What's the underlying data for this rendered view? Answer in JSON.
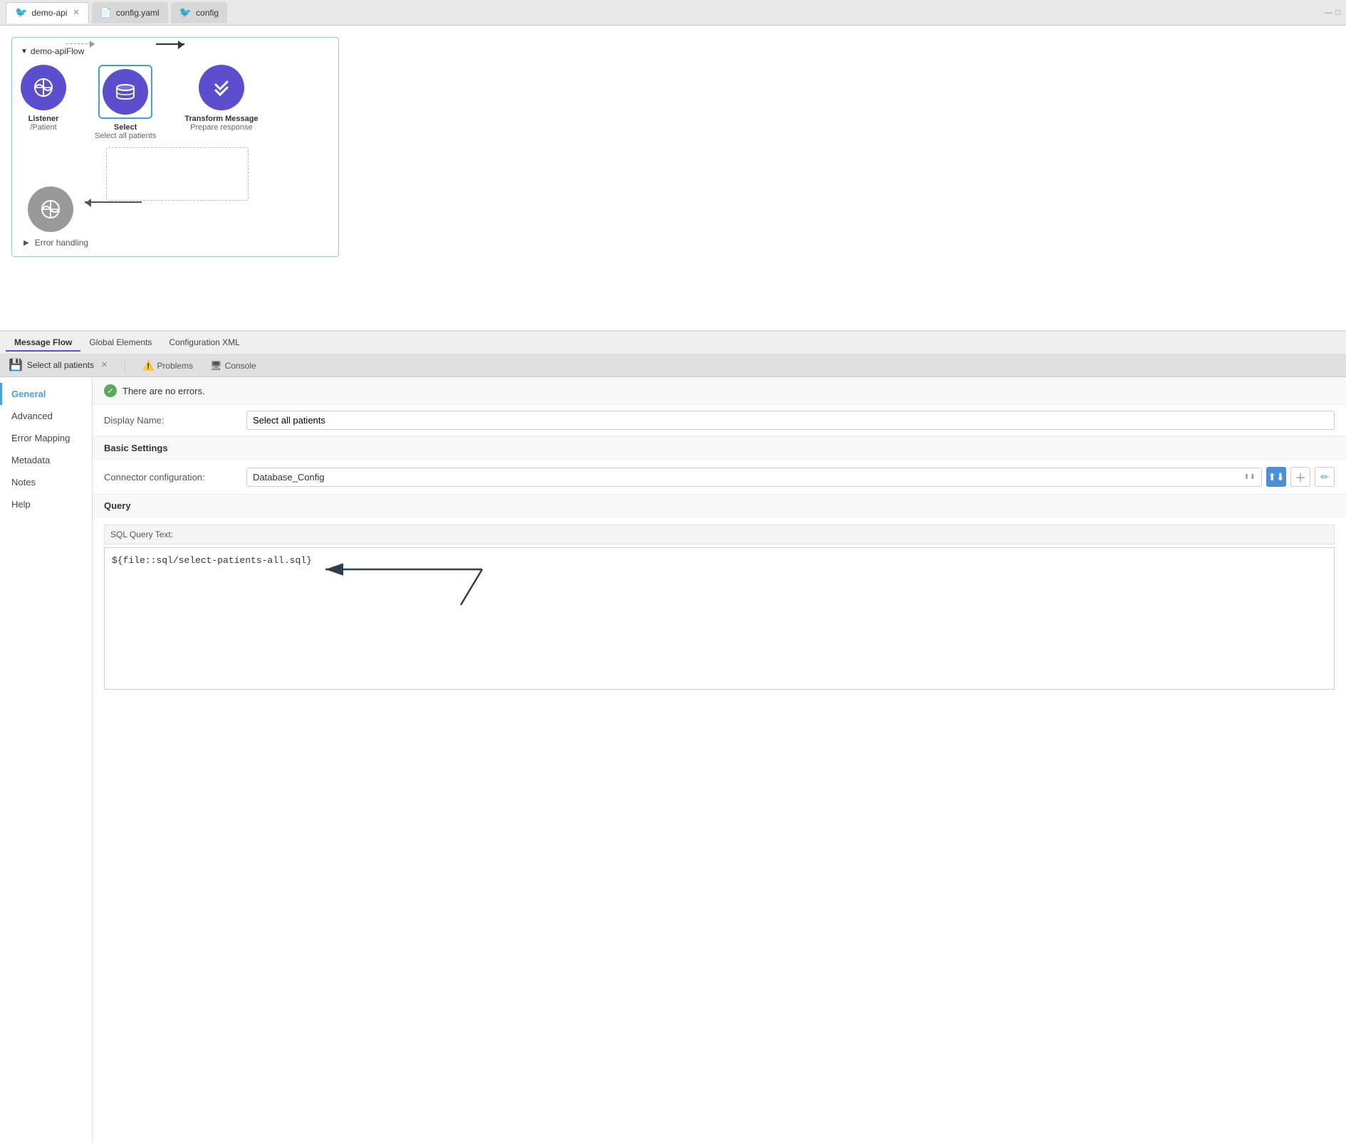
{
  "tabs": [
    {
      "id": "demo-api",
      "label": "demo-api",
      "active": true,
      "closable": true,
      "icon": "bird"
    },
    {
      "id": "config-yaml",
      "label": "config.yaml",
      "active": false,
      "closable": false,
      "icon": "file"
    },
    {
      "id": "config",
      "label": "config",
      "active": false,
      "closable": false,
      "icon": "bird"
    }
  ],
  "flow": {
    "title": "demo-apiFlow",
    "nodes": [
      {
        "id": "listener",
        "type": "globe",
        "color": "blue",
        "label": "Listener",
        "sublabel": "/Patient",
        "selected": false
      },
      {
        "id": "select",
        "type": "database",
        "color": "blue",
        "label": "Select",
        "sublabel": "Select all patients",
        "selected": true
      },
      {
        "id": "transform",
        "type": "check",
        "color": "blue",
        "label": "Transform Message",
        "sublabel": "Prepare response",
        "selected": false
      }
    ],
    "error_handling": "Error handling"
  },
  "bottom_tabs": [
    {
      "label": "Message Flow",
      "active": true
    },
    {
      "label": "Global Elements",
      "active": false
    },
    {
      "label": "Configuration XML",
      "active": false
    }
  ],
  "panel": {
    "title": "Select all patients",
    "tabs": [
      {
        "label": "Problems",
        "icon": "warning",
        "active": false
      },
      {
        "label": "Console",
        "icon": "terminal",
        "active": false
      }
    ],
    "error_message": "There are no errors.",
    "nav": [
      {
        "label": "General",
        "active": true
      },
      {
        "label": "Advanced",
        "active": false
      },
      {
        "label": "Error Mapping",
        "active": false
      },
      {
        "label": "Metadata",
        "active": false
      },
      {
        "label": "Notes",
        "active": false
      },
      {
        "label": "Help",
        "active": false
      }
    ],
    "form": {
      "display_name_label": "Display Name:",
      "display_name_value": "Select all patients",
      "basic_settings_label": "Basic Settings",
      "connector_config_label": "Connector configuration:",
      "connector_config_value": "Database_Config",
      "query_label": "Query",
      "sql_label": "SQL Query Text:",
      "sql_value": "${file::sql/select-patients-all.sql}"
    }
  }
}
